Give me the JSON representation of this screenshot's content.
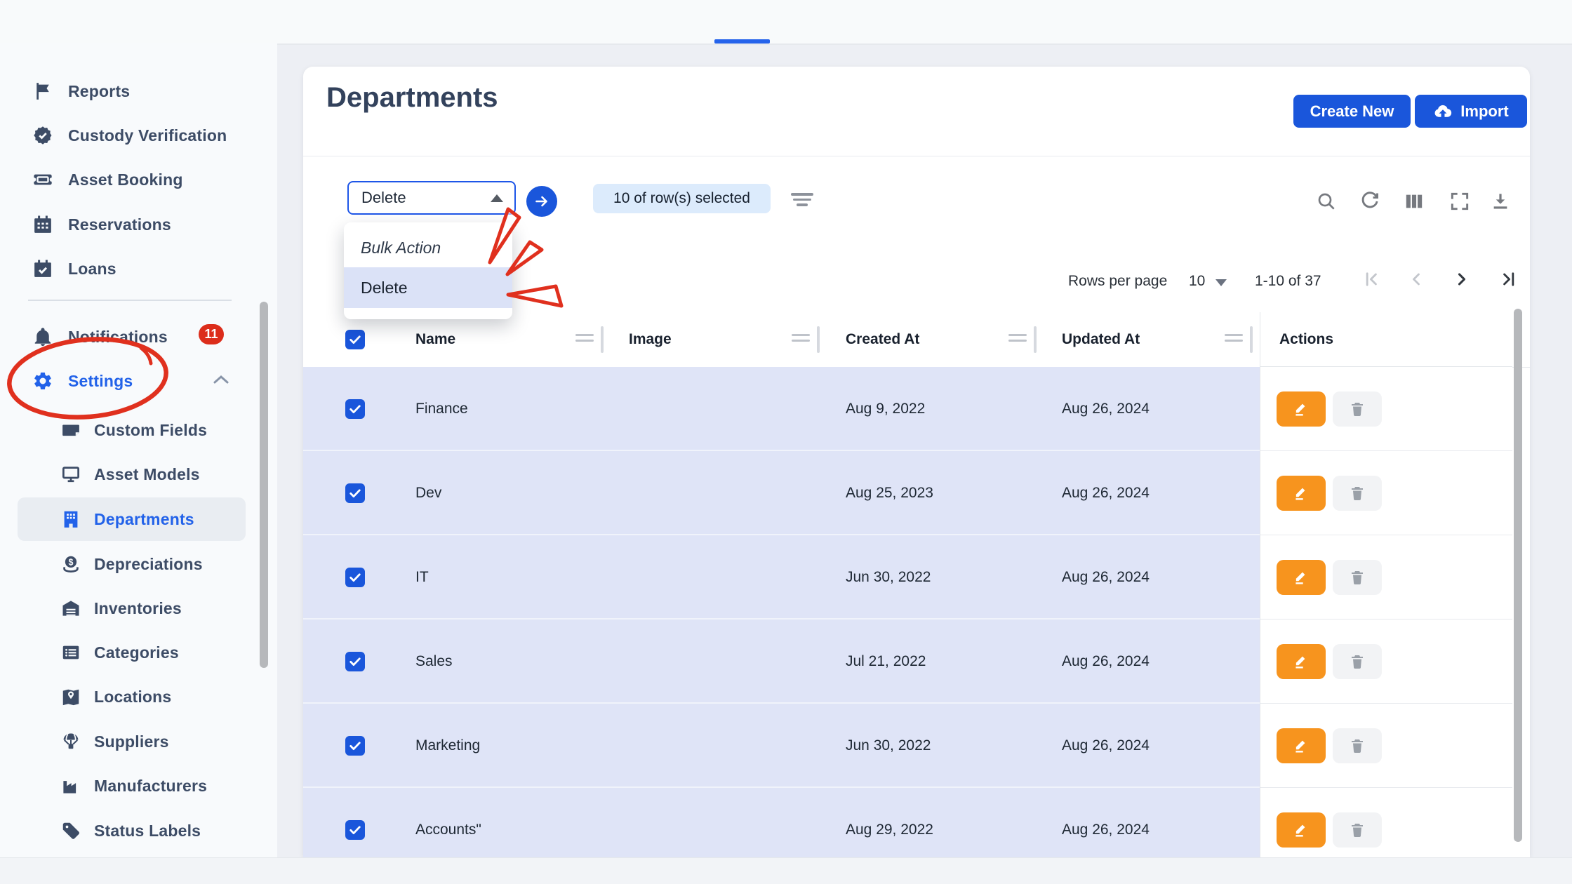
{
  "header": {
    "title": "Departments",
    "create_button": "Create New",
    "import_button": "Import"
  },
  "sidebar": {
    "items": [
      {
        "label": "Reports"
      },
      {
        "label": "Custody Verification"
      },
      {
        "label": "Asset Booking"
      },
      {
        "label": "Reservations"
      },
      {
        "label": "Loans"
      },
      {
        "label": "Notifications",
        "badge": "11"
      },
      {
        "label": "Settings"
      }
    ],
    "settings_children": [
      {
        "label": "Custom Fields"
      },
      {
        "label": "Asset Models"
      },
      {
        "label": "Departments",
        "active": true
      },
      {
        "label": "Depreciations"
      },
      {
        "label": "Inventories"
      },
      {
        "label": "Categories"
      },
      {
        "label": "Locations"
      },
      {
        "label": "Suppliers"
      },
      {
        "label": "Manufacturers"
      },
      {
        "label": "Status Labels"
      }
    ]
  },
  "toolbar": {
    "bulk_select_value": "Delete",
    "selected_chip": "10 of row(s) selected"
  },
  "dropdown": {
    "items": [
      {
        "label": "Bulk Action"
      },
      {
        "label": "Delete"
      }
    ]
  },
  "pagination": {
    "rows_per_page_label": "Rows per page",
    "rows_per_page_value": "10",
    "range_label": "1-10 of 37"
  },
  "table": {
    "columns": [
      "Name",
      "Image",
      "Created At",
      "Updated At",
      "Actions"
    ],
    "rows": [
      {
        "name": "Finance",
        "created_at": "Aug 9, 2022",
        "updated_at": "Aug 26, 2024"
      },
      {
        "name": "Dev",
        "created_at": "Aug 25, 2023",
        "updated_at": "Aug 26, 2024"
      },
      {
        "name": "IT",
        "created_at": "Jun 30, 2022",
        "updated_at": "Aug 26, 2024"
      },
      {
        "name": "Sales",
        "created_at": "Jul 21, 2022",
        "updated_at": "Aug 26, 2024"
      },
      {
        "name": "Marketing",
        "created_at": "Jun 30, 2022",
        "updated_at": "Aug 26, 2024"
      },
      {
        "name": "Accounts\"",
        "created_at": "Aug 29, 2022",
        "updated_at": "Aug 26, 2024"
      }
    ]
  },
  "icons": {
    "toolbar": [
      "search-icon",
      "refresh-icon",
      "columns-icon",
      "fullscreen-icon",
      "download-icon"
    ],
    "row_actions": [
      "edit-pencil-icon",
      "trash-icon"
    ]
  },
  "colors": {
    "accent_blue": "#1a56db",
    "settings_blue": "#2262e9",
    "selected_row": "#dfe4f7",
    "edit_orange": "#f7941e",
    "annotation_red": "#e0301e",
    "badge_red": "#dc2d1b"
  }
}
